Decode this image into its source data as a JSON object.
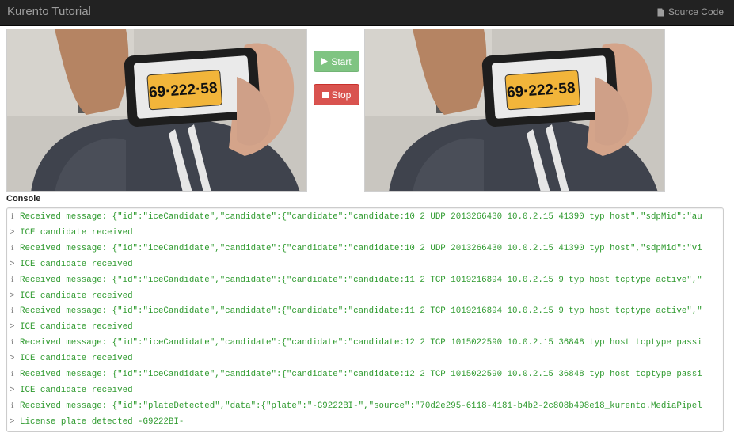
{
  "navbar": {
    "brand": "Kurento Tutorial",
    "source_code_label": "Source Code"
  },
  "controls": {
    "start_label": "Start",
    "stop_label": "Stop"
  },
  "videos": {
    "left_plate_text": "69·222·58",
    "right_plate_text": "69·222·58"
  },
  "console": {
    "title": "Console",
    "lines": [
      {
        "prefix": "ℹ",
        "type": "info",
        "text": "Received message: {\"id\":\"iceCandidate\",\"candidate\":{\"candidate\":\"candidate:10 2 UDP 2013266430 10.0.2.15 41390 typ host\",\"sdpMid\":\"au"
      },
      {
        "prefix": ">",
        "type": "log",
        "text": "ICE candidate received"
      },
      {
        "prefix": "ℹ",
        "type": "info",
        "text": "Received message: {\"id\":\"iceCandidate\",\"candidate\":{\"candidate\":\"candidate:10 2 UDP 2013266430 10.0.2.15 41390 typ host\",\"sdpMid\":\"vi"
      },
      {
        "prefix": ">",
        "type": "log",
        "text": "ICE candidate received"
      },
      {
        "prefix": "ℹ",
        "type": "info",
        "text": "Received message: {\"id\":\"iceCandidate\",\"candidate\":{\"candidate\":\"candidate:11 2 TCP 1019216894 10.0.2.15 9 typ host tcptype active\",\""
      },
      {
        "prefix": ">",
        "type": "log",
        "text": "ICE candidate received"
      },
      {
        "prefix": "ℹ",
        "type": "info",
        "text": "Received message: {\"id\":\"iceCandidate\",\"candidate\":{\"candidate\":\"candidate:11 2 TCP 1019216894 10.0.2.15 9 typ host tcptype active\",\""
      },
      {
        "prefix": ">",
        "type": "log",
        "text": "ICE candidate received"
      },
      {
        "prefix": "ℹ",
        "type": "info",
        "text": "Received message: {\"id\":\"iceCandidate\",\"candidate\":{\"candidate\":\"candidate:12 2 TCP 1015022590 10.0.2.15 36848 typ host tcptype passi"
      },
      {
        "prefix": ">",
        "type": "log",
        "text": "ICE candidate received"
      },
      {
        "prefix": "ℹ",
        "type": "info",
        "text": "Received message: {\"id\":\"iceCandidate\",\"candidate\":{\"candidate\":\"candidate:12 2 TCP 1015022590 10.0.2.15 36848 typ host tcptype passi"
      },
      {
        "prefix": ">",
        "type": "log",
        "text": "ICE candidate received"
      },
      {
        "prefix": "ℹ",
        "type": "info",
        "text": "Received message: {\"id\":\"plateDetected\",\"data\":{\"plate\":\"-G9222BI-\",\"source\":\"70d2e295-6118-4181-b4b2-2c808b498e18_kurento.MediaPipel"
      },
      {
        "prefix": ">",
        "type": "log",
        "text": "License plate detected -G9222BI-"
      }
    ]
  },
  "colors": {
    "navbar_bg": "#222222",
    "navbar_text": "#9d9d9d",
    "start_button": "#7fc482",
    "stop_button": "#d9534f",
    "console_text": "#2e9a2e"
  }
}
